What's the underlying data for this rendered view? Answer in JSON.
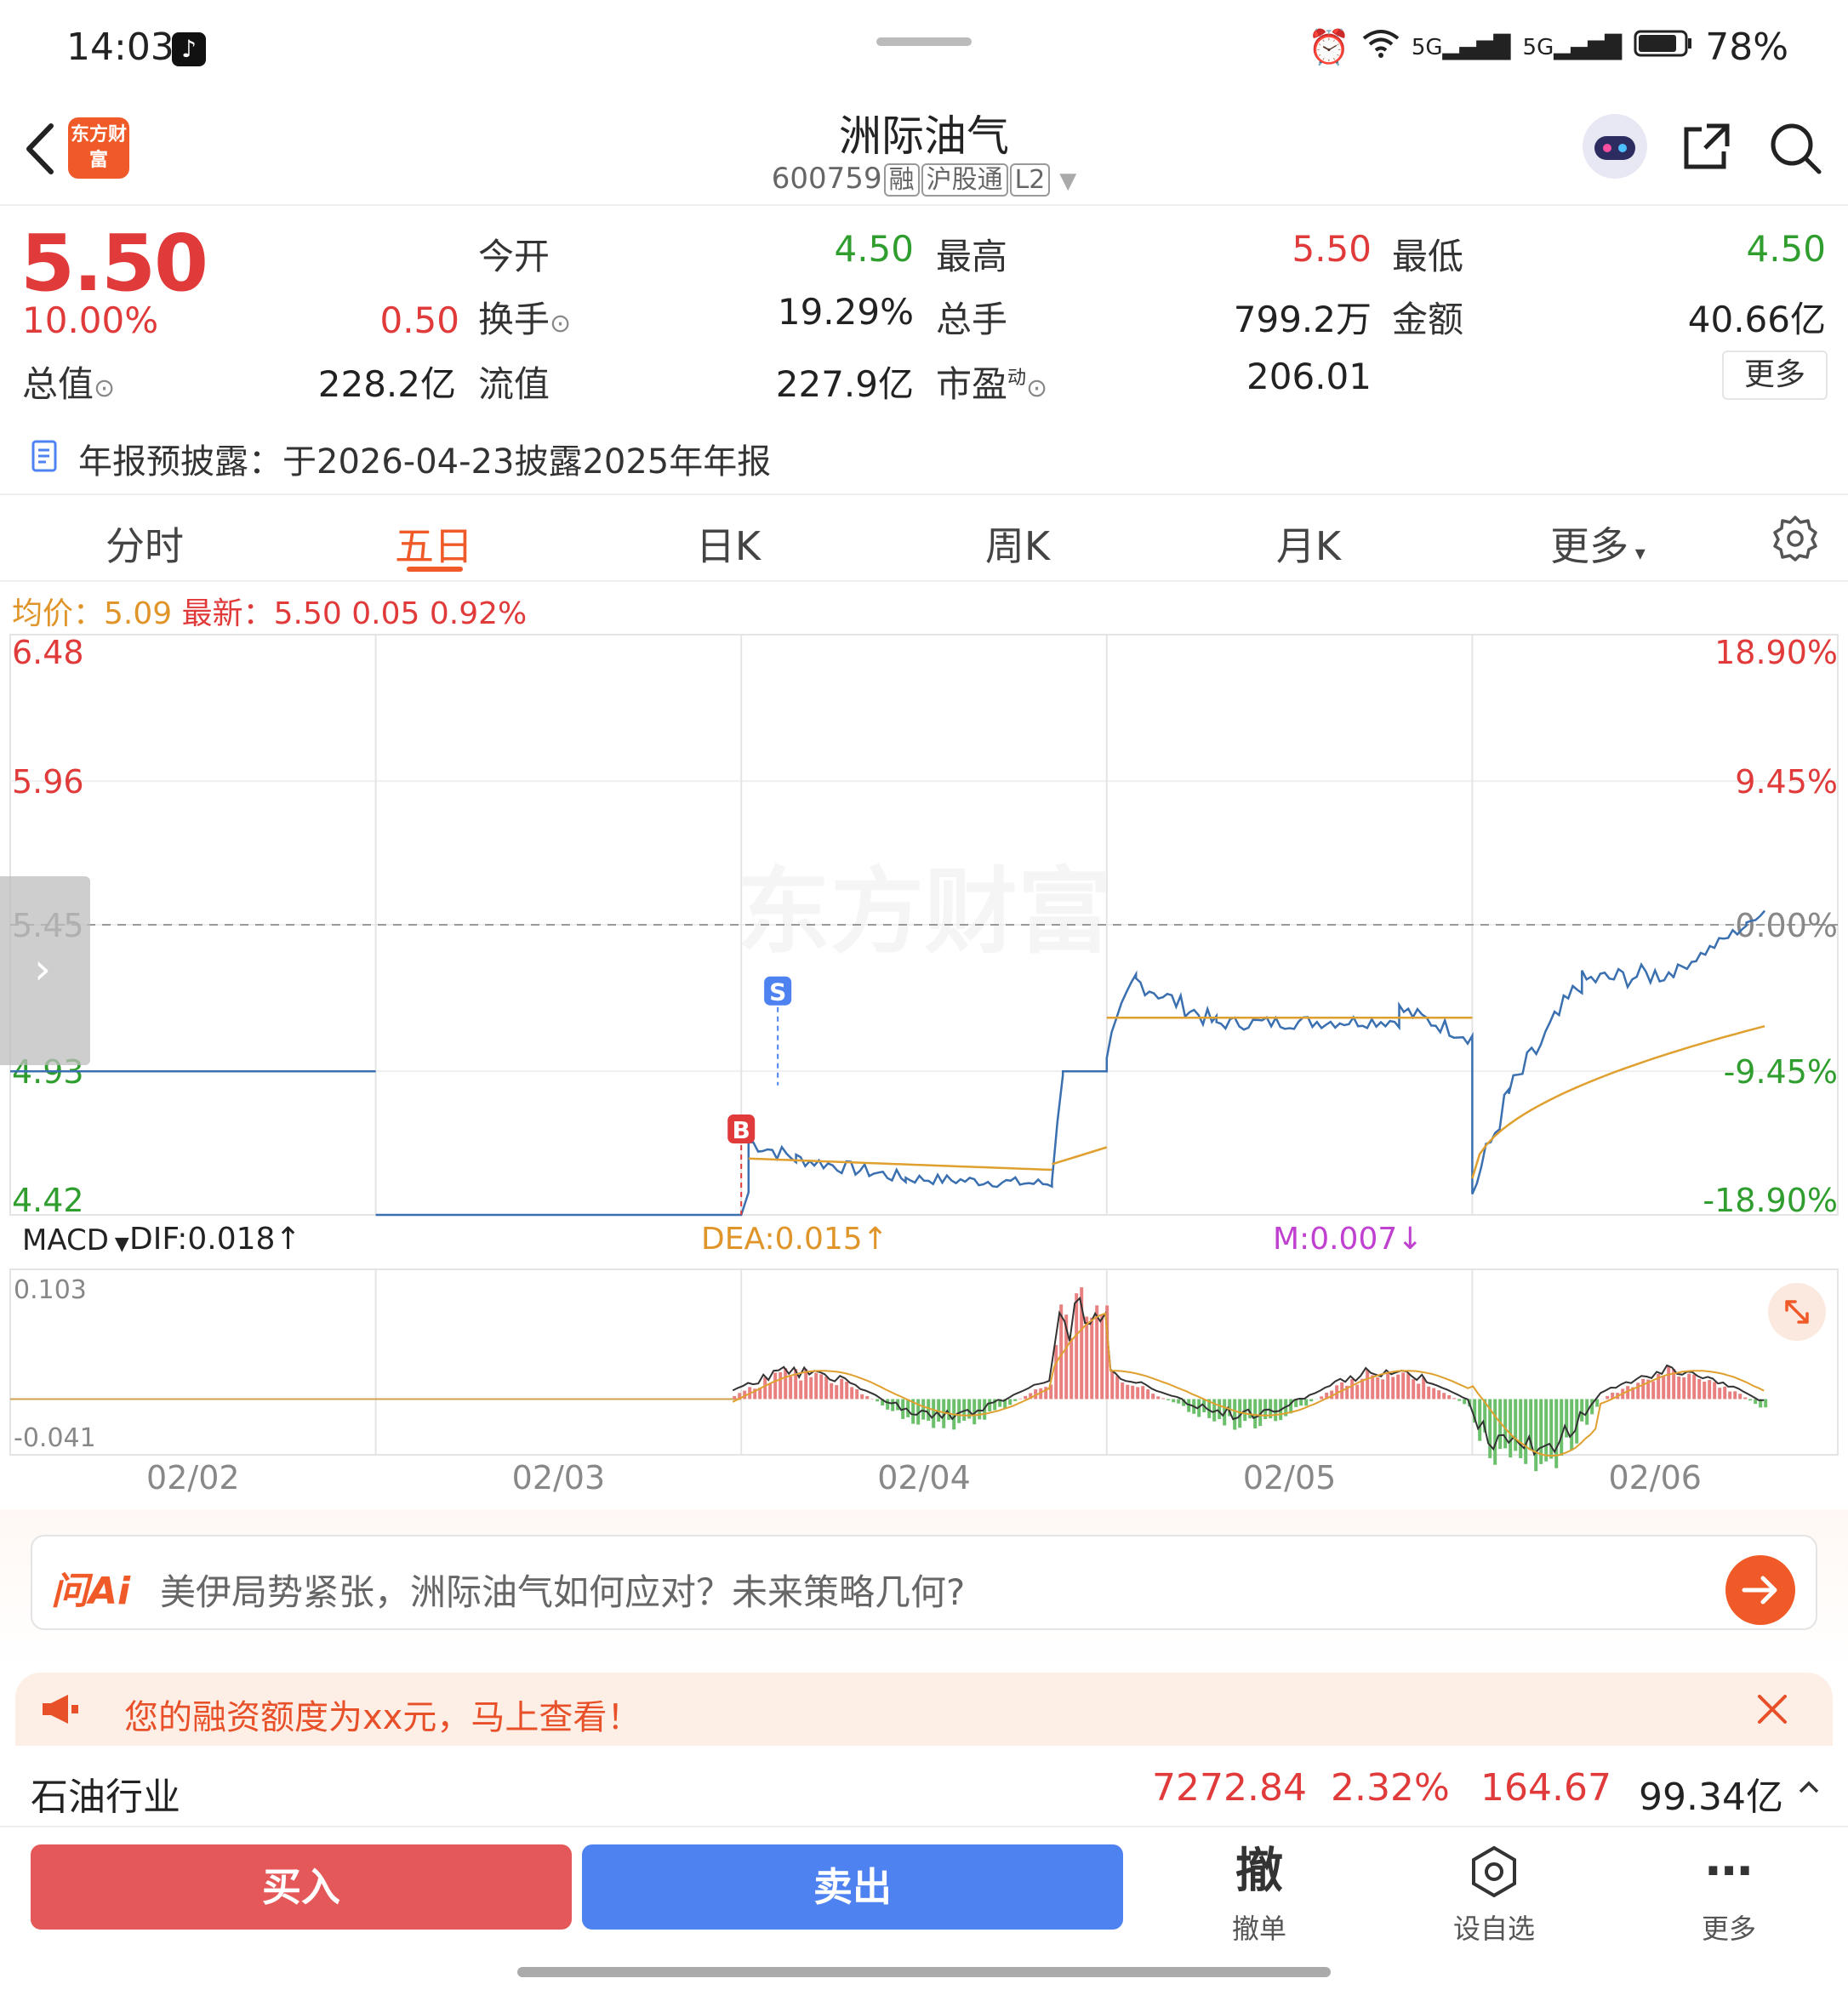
{
  "status": {
    "time": "14:03",
    "battery": "78%",
    "network": "5G 5G"
  },
  "header": {
    "logo_text": "东方财富",
    "stock_name": "洲际油气",
    "code": "600759",
    "tags": [
      "融",
      "沪股通",
      "L2"
    ]
  },
  "quote": {
    "price": "5.50",
    "change_pct": "10.00%",
    "change_val": "0.50",
    "rows": [
      [
        {
          "label": "今开",
          "value": "4.50",
          "color": "green"
        },
        {
          "label": "最高",
          "value": "5.50",
          "color": "red"
        },
        {
          "label": "最低",
          "value": "4.50",
          "color": "green"
        }
      ],
      [
        {
          "label": "换手",
          "value": "19.29%",
          "color": "dark"
        },
        {
          "label": "总手",
          "value": "799.2万",
          "color": "dark"
        },
        {
          "label": "金额",
          "value": "40.66亿",
          "color": "dark"
        }
      ],
      [
        {
          "label": "流值",
          "value": "227.9亿",
          "color": "dark"
        },
        {
          "label": "市盈",
          "value": "206.01",
          "color": "dark"
        }
      ]
    ],
    "total_value_label": "总值",
    "total_value": "228.2亿",
    "pe_sup": "动",
    "more_label": "更多",
    "notice": "年报预披露：于2026-04-23披露2025年年报"
  },
  "tabs": {
    "items": [
      "分时",
      "五日",
      "日K",
      "周K",
      "月K",
      "更多"
    ],
    "active": "五日"
  },
  "price_info": {
    "avg_label": "均价：",
    "avg_value": "5.09",
    "latest_label": "最新：",
    "latest_value": "5.50",
    "diff": "0.05",
    "diff_pct": "0.92%"
  },
  "chart_data": [
    {
      "type": "line",
      "title": "",
      "x": [
        "02/02",
        "02/03",
        "02/04",
        "02/05",
        "02/06"
      ],
      "ylim": [
        4.42,
        6.48
      ],
      "y_ticks": [
        "6.48",
        "5.96",
        "5.45",
        "4.93",
        "4.42"
      ],
      "y2_ticks": [
        "18.90%",
        "9.45%",
        "0.00%",
        "-9.45%",
        "-18.90%"
      ],
      "ref_line": 5.45,
      "series": [],
      "markers": [
        {
          "label": "B",
          "day": "02/04",
          "value": 4.42
        },
        {
          "label": "S",
          "day": "02/04",
          "value": 4.88
        }
      ]
    },
    {
      "type": "bar",
      "title": "",
      "ylim": [
        -0.041,
        0.103
      ],
      "y_ticks": [
        "0.103",
        "-0.041"
      ],
      "legend": [
        "MACD",
        "DIF:0.018↑",
        "DEA:0.015↑",
        "M:0.007↓"
      ],
      "series": []
    }
  ],
  "macd": {
    "name": "MACD",
    "dif": "DIF:0.018↑",
    "dea": "DEA:0.015↑",
    "m": "M:0.007↓"
  },
  "watermark": "东方财富",
  "ai": {
    "logo": "问Ai",
    "prompt": "美伊局势紧张，洲际油气如何应对？未来策略几何?"
  },
  "financing": {
    "text": "您的融资额度为xx元，马上查看！"
  },
  "industry": {
    "name": "石油行业",
    "price": "7272.84",
    "pct": "2.32%",
    "change": "164.67",
    "amount": "99.34亿"
  },
  "bottom": {
    "buy": "买入",
    "sell": "卖出",
    "cancel_big": "撤",
    "cancel_small": "撤单",
    "watch_small": "设自选",
    "more_small": "更多"
  },
  "colors": {
    "up": "#e03a3a",
    "down": "#2f9e2f",
    "brand": "#f05a28",
    "price_line": "#3a6fb0",
    "avg_line": "#e0a030",
    "buy": "#e5585a",
    "sell": "#4d82f0"
  }
}
